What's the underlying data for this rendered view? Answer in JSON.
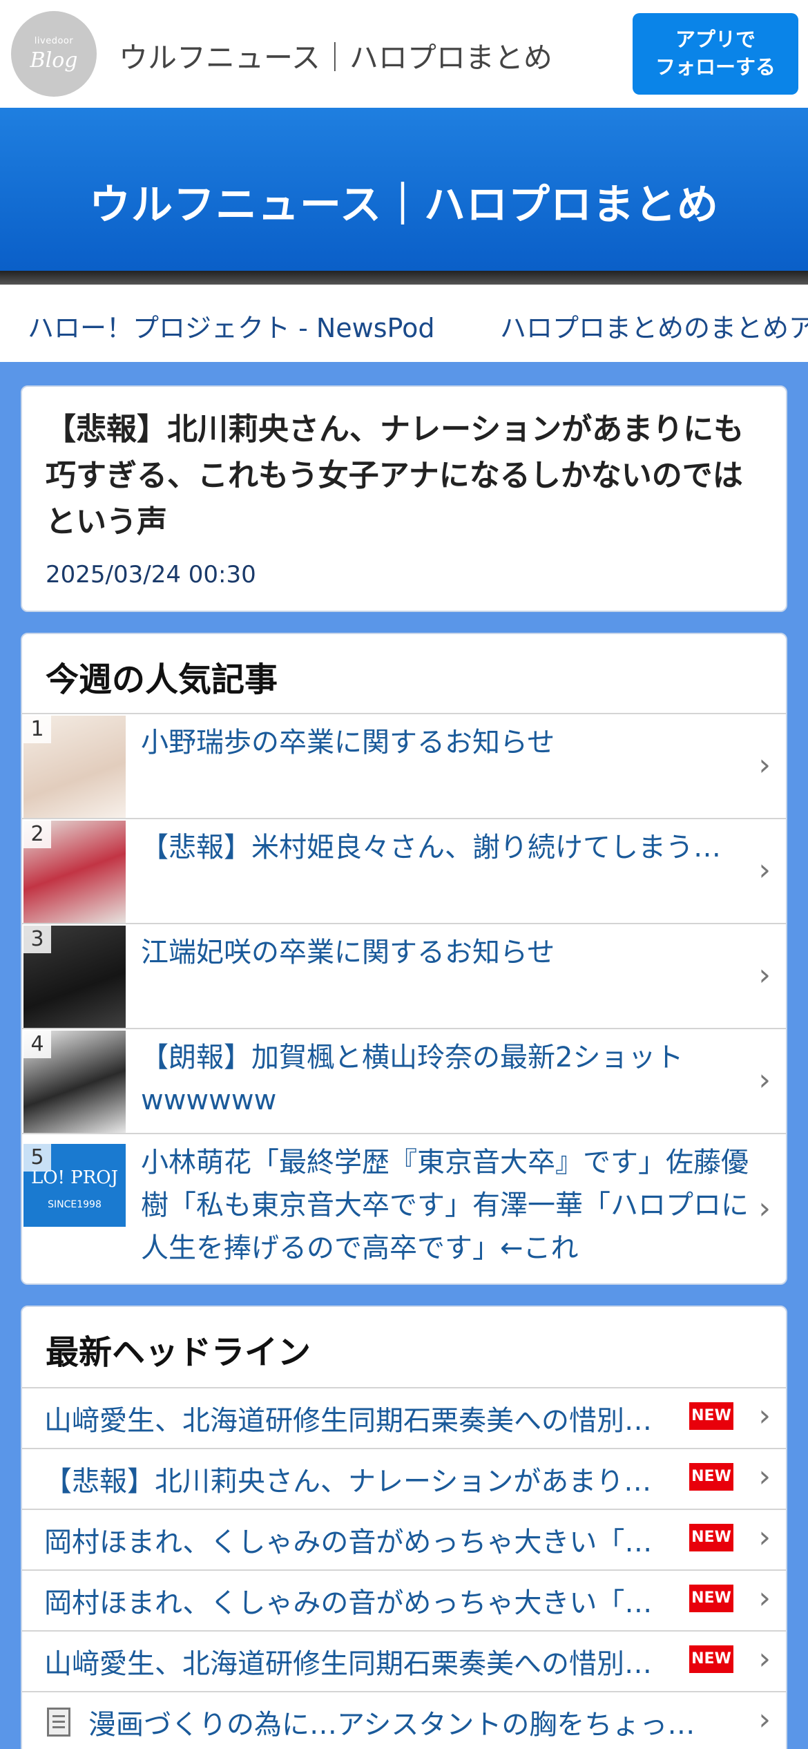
{
  "header": {
    "logo_small": "livedoor",
    "logo_big": "Blog",
    "site_name": "ウルフニュース｜ハロプロまとめ",
    "follow_button": "アプリで\nフォローする"
  },
  "banner": {
    "title": "ウルフニュース｜ハロプロまとめ"
  },
  "link_strip": [
    "ハロー！プロジェクト - NewsPod",
    "ハロプロまとめのまとめア"
  ],
  "article": {
    "title": "【悲報】北川莉央さん、ナレーションがあまりにも巧すぎる、これもう女子アナになるしかないのではという声",
    "date": "2025/03/24 00:30"
  },
  "popular": {
    "heading": "今週の人気記事",
    "items": [
      {
        "rank": "1",
        "title": "小野瑞歩の卒業に関するお知らせ",
        "thumb_color": "#e8d8c8"
      },
      {
        "rank": "2",
        "title": "【悲報】米村姫良々さん、謝り続けてしまう…",
        "thumb_color": "#b83040"
      },
      {
        "rank": "3",
        "title": "江端妃咲の卒業に関するお知らせ",
        "thumb_color": "#2a2a2a"
      },
      {
        "rank": "4",
        "title": "【朗報】加賀楓と横山玲奈の最新2ショットwwwwww",
        "thumb_color": "#d8d8d8"
      },
      {
        "rank": "5",
        "title": "小林萌花「最終学歴『東京音大卒』です」佐藤優樹「私も東京音大卒です」有澤一華「ハロプロに人生を捧げるので高卒です」←これ",
        "thumb_color": "#1a7ad0",
        "thumb_text": "LO! PROJ",
        "thumb_sub": "SINCE1998"
      }
    ]
  },
  "latest": {
    "heading": "最新ヘッドライン",
    "new_label": "NEW",
    "items": [
      {
        "title": "山﨑愛生、北海道研修生同期石栗奏美への惜別…",
        "is_new": true
      },
      {
        "title": "【悲報】北川莉央さん、ナレーションがあまり…",
        "is_new": true
      },
      {
        "title": "岡村ほまれ、くしゃみの音がめっちゃ大きい「…",
        "is_new": true
      },
      {
        "title": "岡村ほまれ、くしゃみの音がめっちゃ大きい「…",
        "is_new": true
      },
      {
        "title": "山﨑愛生、北海道研修生同期石栗奏美への惜別…",
        "is_new": true
      },
      {
        "title": "漫画づくりの為に…アシスタントの胸をちょっ…",
        "is_new": false,
        "icon": "document-icon"
      }
    ]
  },
  "colors": {
    "background": "#5a96e8",
    "accent": "#0a84e8",
    "new_badge": "#e8000b",
    "link": "#1a5a9a"
  }
}
